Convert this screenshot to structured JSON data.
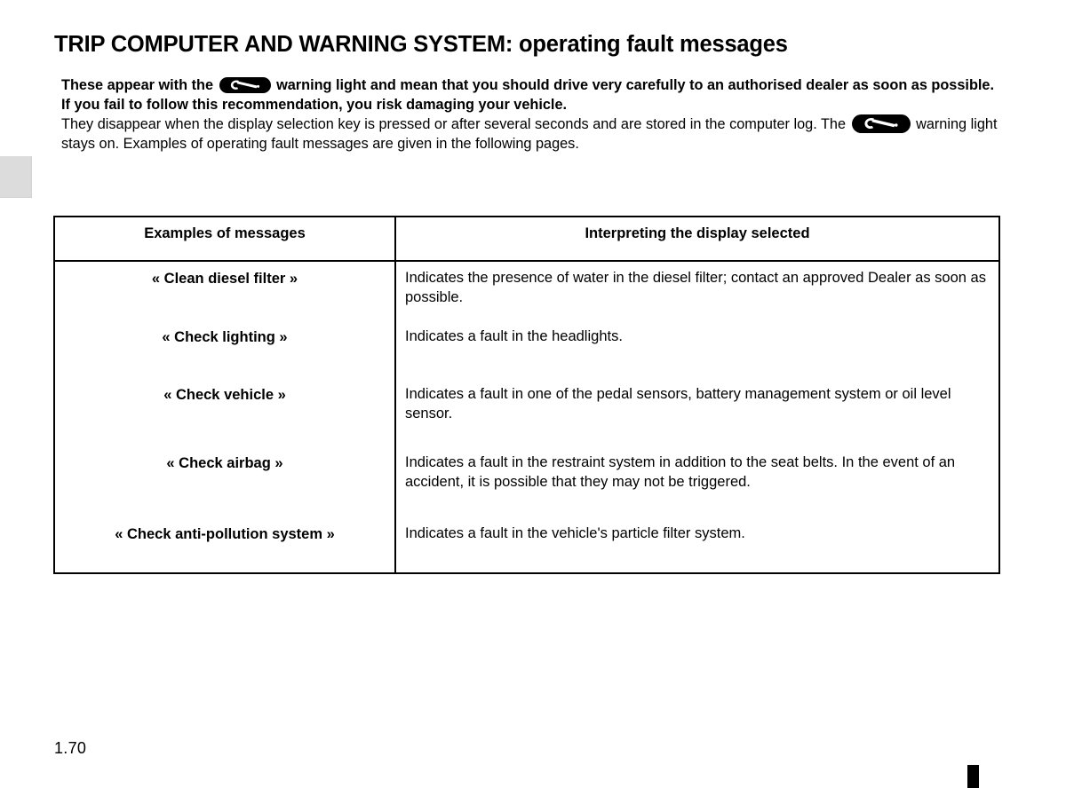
{
  "document": {
    "title": "TRIP COMPUTER AND WARNING SYSTEM: operating fault messages",
    "page_number": "1.70"
  },
  "icons": {
    "service_warning_light": "wrench-warning-light-icon"
  },
  "intro": {
    "bold_line_1_before_icon": "These appear with the",
    "bold_line_1_after_icon": "warning light and mean that you should drive very carefully to an authorised dealer as soon as possible. If you fail to follow this recommendation, you risk damaging your vehicle.",
    "plain_line_before_icon": "They disappear when the display selection key is pressed or after several seconds and are stored in the computer log. The",
    "plain_line_after_icon": "warning light stays on. Examples of operating fault messages are given in the following pages."
  },
  "table": {
    "headers": {
      "messages": "Examples of messages",
      "interpretation": "Interpreting the display selected"
    },
    "rows": [
      {
        "message": "« Clean diesel filter »",
        "description": "Indicates the presence of water in the diesel filter; contact an approved Dealer as soon as possible."
      },
      {
        "message": "« Check lighting »",
        "description": "Indicates a fault in the headlights."
      },
      {
        "message": "« Check vehicle »",
        "description": "Indicates a fault in one of the pedal sensors, battery management system or oil level sensor."
      },
      {
        "message": "« Check airbag »",
        "description": "Indicates a fault in the restraint system in addition to the seat belts. In the event of an accident, it is possible that they may not be triggered."
      },
      {
        "message": "« Check anti-pollution system »",
        "description": "Indicates a fault in the vehicle's particle filter system."
      }
    ]
  },
  "colors": {
    "text": "#000000",
    "background": "#ffffff",
    "side_tab": "#dcdcdc",
    "corner_tab": "#000000"
  }
}
